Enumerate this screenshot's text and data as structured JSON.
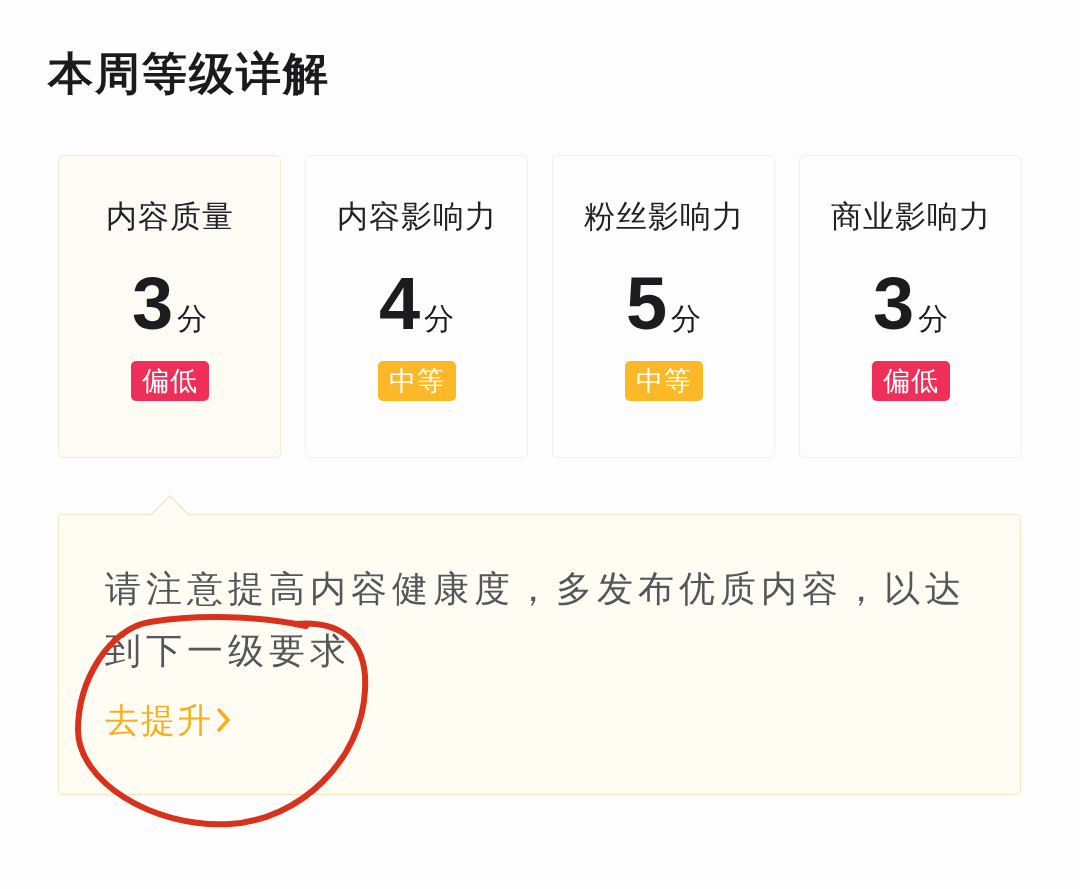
{
  "title": "本周等级详解",
  "cards": [
    {
      "label": "内容质量",
      "score": "3",
      "unit": "分",
      "badge": {
        "text": "偏低",
        "color": "#ee2f5a"
      },
      "selected": true
    },
    {
      "label": "内容影响力",
      "score": "4",
      "unit": "分",
      "badge": {
        "text": "中等",
        "color": "#fbb827"
      },
      "selected": false
    },
    {
      "label": "粉丝影响力",
      "score": "5",
      "unit": "分",
      "badge": {
        "text": "中等",
        "color": "#fbb827"
      },
      "selected": false
    },
    {
      "label": "商业影响力",
      "score": "3",
      "unit": "分",
      "badge": {
        "text": "偏低",
        "color": "#ee2f5a"
      },
      "selected": false
    }
  ],
  "tip": {
    "text": "请注意提高内容健康度，多发布优质内容，以达到下一级要求",
    "link": "去提升"
  }
}
